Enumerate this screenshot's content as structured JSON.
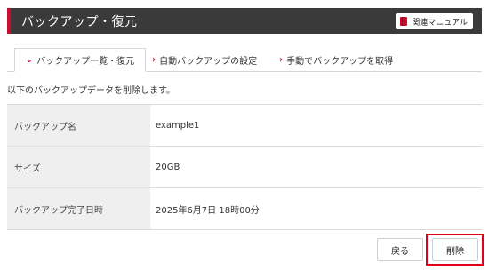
{
  "header": {
    "title": "バックアップ・復元",
    "manual_label": "関連マニュアル"
  },
  "tabs": [
    {
      "label": "バックアップ一覧・復元",
      "active": true
    },
    {
      "label": "自動バックアップの設定",
      "active": false
    },
    {
      "label": "手動でバックアップを取得",
      "active": false
    }
  ],
  "message": "以下のバックアップデータを削除します。",
  "details": [
    {
      "label": "バックアップ名",
      "value": "example1"
    },
    {
      "label": "サイズ",
      "value": "20GB"
    },
    {
      "label": "バックアップ完了日時",
      "value": "2025年6月7日 18時00分"
    }
  ],
  "buttons": {
    "back_label": "戻る",
    "delete_label": "削除"
  },
  "colors": {
    "accent": "#c8102e",
    "header_bg": "#3a3a3a",
    "highlight": "#e0001b"
  }
}
